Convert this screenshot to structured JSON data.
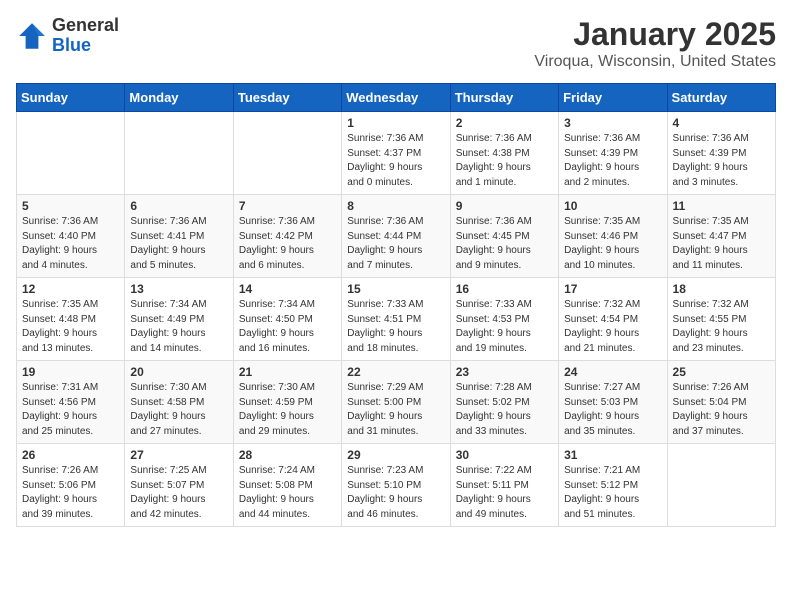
{
  "header": {
    "logo_general": "General",
    "logo_blue": "Blue",
    "month_title": "January 2025",
    "location": "Viroqua, Wisconsin, United States"
  },
  "days_of_week": [
    "Sunday",
    "Monday",
    "Tuesday",
    "Wednesday",
    "Thursday",
    "Friday",
    "Saturday"
  ],
  "weeks": [
    [
      {
        "day": "",
        "info": ""
      },
      {
        "day": "",
        "info": ""
      },
      {
        "day": "",
        "info": ""
      },
      {
        "day": "1",
        "info": "Sunrise: 7:36 AM\nSunset: 4:37 PM\nDaylight: 9 hours\nand 0 minutes."
      },
      {
        "day": "2",
        "info": "Sunrise: 7:36 AM\nSunset: 4:38 PM\nDaylight: 9 hours\nand 1 minute."
      },
      {
        "day": "3",
        "info": "Sunrise: 7:36 AM\nSunset: 4:39 PM\nDaylight: 9 hours\nand 2 minutes."
      },
      {
        "day": "4",
        "info": "Sunrise: 7:36 AM\nSunset: 4:39 PM\nDaylight: 9 hours\nand 3 minutes."
      }
    ],
    [
      {
        "day": "5",
        "info": "Sunrise: 7:36 AM\nSunset: 4:40 PM\nDaylight: 9 hours\nand 4 minutes."
      },
      {
        "day": "6",
        "info": "Sunrise: 7:36 AM\nSunset: 4:41 PM\nDaylight: 9 hours\nand 5 minutes."
      },
      {
        "day": "7",
        "info": "Sunrise: 7:36 AM\nSunset: 4:42 PM\nDaylight: 9 hours\nand 6 minutes."
      },
      {
        "day": "8",
        "info": "Sunrise: 7:36 AM\nSunset: 4:44 PM\nDaylight: 9 hours\nand 7 minutes."
      },
      {
        "day": "9",
        "info": "Sunrise: 7:36 AM\nSunset: 4:45 PM\nDaylight: 9 hours\nand 9 minutes."
      },
      {
        "day": "10",
        "info": "Sunrise: 7:35 AM\nSunset: 4:46 PM\nDaylight: 9 hours\nand 10 minutes."
      },
      {
        "day": "11",
        "info": "Sunrise: 7:35 AM\nSunset: 4:47 PM\nDaylight: 9 hours\nand 11 minutes."
      }
    ],
    [
      {
        "day": "12",
        "info": "Sunrise: 7:35 AM\nSunset: 4:48 PM\nDaylight: 9 hours\nand 13 minutes."
      },
      {
        "day": "13",
        "info": "Sunrise: 7:34 AM\nSunset: 4:49 PM\nDaylight: 9 hours\nand 14 minutes."
      },
      {
        "day": "14",
        "info": "Sunrise: 7:34 AM\nSunset: 4:50 PM\nDaylight: 9 hours\nand 16 minutes."
      },
      {
        "day": "15",
        "info": "Sunrise: 7:33 AM\nSunset: 4:51 PM\nDaylight: 9 hours\nand 18 minutes."
      },
      {
        "day": "16",
        "info": "Sunrise: 7:33 AM\nSunset: 4:53 PM\nDaylight: 9 hours\nand 19 minutes."
      },
      {
        "day": "17",
        "info": "Sunrise: 7:32 AM\nSunset: 4:54 PM\nDaylight: 9 hours\nand 21 minutes."
      },
      {
        "day": "18",
        "info": "Sunrise: 7:32 AM\nSunset: 4:55 PM\nDaylight: 9 hours\nand 23 minutes."
      }
    ],
    [
      {
        "day": "19",
        "info": "Sunrise: 7:31 AM\nSunset: 4:56 PM\nDaylight: 9 hours\nand 25 minutes."
      },
      {
        "day": "20",
        "info": "Sunrise: 7:30 AM\nSunset: 4:58 PM\nDaylight: 9 hours\nand 27 minutes."
      },
      {
        "day": "21",
        "info": "Sunrise: 7:30 AM\nSunset: 4:59 PM\nDaylight: 9 hours\nand 29 minutes."
      },
      {
        "day": "22",
        "info": "Sunrise: 7:29 AM\nSunset: 5:00 PM\nDaylight: 9 hours\nand 31 minutes."
      },
      {
        "day": "23",
        "info": "Sunrise: 7:28 AM\nSunset: 5:02 PM\nDaylight: 9 hours\nand 33 minutes."
      },
      {
        "day": "24",
        "info": "Sunrise: 7:27 AM\nSunset: 5:03 PM\nDaylight: 9 hours\nand 35 minutes."
      },
      {
        "day": "25",
        "info": "Sunrise: 7:26 AM\nSunset: 5:04 PM\nDaylight: 9 hours\nand 37 minutes."
      }
    ],
    [
      {
        "day": "26",
        "info": "Sunrise: 7:26 AM\nSunset: 5:06 PM\nDaylight: 9 hours\nand 39 minutes."
      },
      {
        "day": "27",
        "info": "Sunrise: 7:25 AM\nSunset: 5:07 PM\nDaylight: 9 hours\nand 42 minutes."
      },
      {
        "day": "28",
        "info": "Sunrise: 7:24 AM\nSunset: 5:08 PM\nDaylight: 9 hours\nand 44 minutes."
      },
      {
        "day": "29",
        "info": "Sunrise: 7:23 AM\nSunset: 5:10 PM\nDaylight: 9 hours\nand 46 minutes."
      },
      {
        "day": "30",
        "info": "Sunrise: 7:22 AM\nSunset: 5:11 PM\nDaylight: 9 hours\nand 49 minutes."
      },
      {
        "day": "31",
        "info": "Sunrise: 7:21 AM\nSunset: 5:12 PM\nDaylight: 9 hours\nand 51 minutes."
      },
      {
        "day": "",
        "info": ""
      }
    ]
  ]
}
